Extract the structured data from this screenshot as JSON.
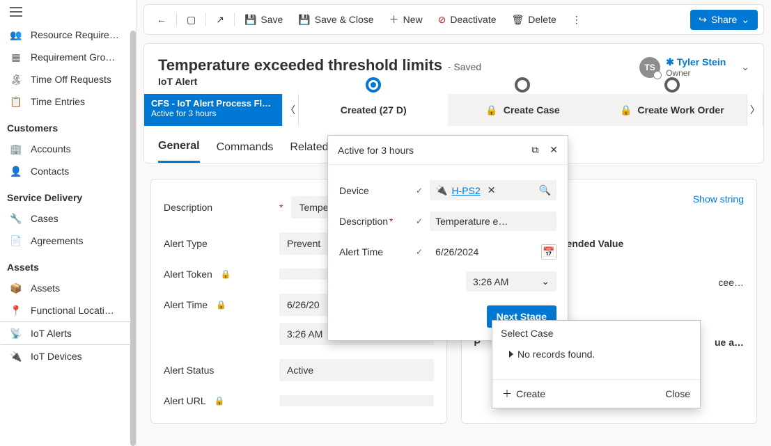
{
  "sidebar": {
    "groups": [
      {
        "items": [
          {
            "icon": "people",
            "label": "Resource Require…"
          },
          {
            "icon": "grid",
            "label": "Requirement Gro…"
          },
          {
            "icon": "timeoff",
            "label": "Time Off Requests"
          },
          {
            "icon": "calendar",
            "label": "Time Entries"
          }
        ]
      },
      {
        "title": "Customers",
        "items": [
          {
            "icon": "account",
            "label": "Accounts"
          },
          {
            "icon": "contact",
            "label": "Contacts"
          }
        ]
      },
      {
        "title": "Service Delivery",
        "items": [
          {
            "icon": "wrench",
            "label": "Cases"
          },
          {
            "icon": "doc",
            "label": "Agreements"
          }
        ]
      },
      {
        "title": "Assets",
        "items": [
          {
            "icon": "cube",
            "label": "Assets"
          },
          {
            "icon": "pin",
            "label": "Functional Locati…"
          },
          {
            "icon": "alert",
            "label": "IoT Alerts",
            "selected": true
          },
          {
            "icon": "device",
            "label": "IoT Devices"
          }
        ]
      }
    ]
  },
  "commands": {
    "back": "Back",
    "save": "Save",
    "save_close": "Save & Close",
    "new": "New",
    "deactivate": "Deactivate",
    "delete": "Delete",
    "share": "Share"
  },
  "record": {
    "title": "Temperature exceeded threshold limits",
    "saved_tag": "- Saved",
    "entity": "IoT Alert",
    "owner_initials": "TS",
    "owner_name": "Tyler Stein",
    "owner_role": "Owner"
  },
  "bpf": {
    "name": "CFS - IoT Alert Process Fl…",
    "active": "Active for 3 hours",
    "stages": [
      {
        "label": "Created  (27 D)",
        "state": "done",
        "current": true
      },
      {
        "label": "Create Case",
        "state": "pending",
        "locked": true
      },
      {
        "label": "Create Work Order",
        "state": "pending",
        "locked": true
      }
    ]
  },
  "tabs": [
    {
      "label": "General",
      "active": true
    },
    {
      "label": "Commands"
    },
    {
      "label": "Related"
    }
  ],
  "form": {
    "left": [
      {
        "label": "Description",
        "required": true,
        "value": "Temper"
      },
      {
        "label": "Alert Type",
        "value": "Prevent"
      },
      {
        "label": "Alert Token",
        "lock": true,
        "value": ""
      },
      {
        "label": "Alert Time",
        "lock": true,
        "value": "6/26/20",
        "extra_value": "3:26 AM"
      },
      {
        "label": "Alert Status",
        "value": "Active"
      },
      {
        "label": "Alert URL",
        "lock": true,
        "value": ""
      }
    ],
    "right": {
      "show_string": "Show string",
      "heading": "Exceeding Recommended Value",
      "row1": "cee…",
      "row2_a": "a",
      "row2_p": "P",
      "row2_tail": "ue a…"
    }
  },
  "flyout": {
    "title": "Active for 3 hours",
    "device_label": "Device",
    "device_value": "H-PS2",
    "desc_label": "Description",
    "desc_value": "Temperature e…",
    "time_label": "Alert Time",
    "date_value": "6/26/2024",
    "time_value": "3:26 AM",
    "next_stage": "Next Stage"
  },
  "lookup": {
    "title": "Select Case",
    "empty": "No records found.",
    "create": "Create",
    "close": "Close"
  }
}
